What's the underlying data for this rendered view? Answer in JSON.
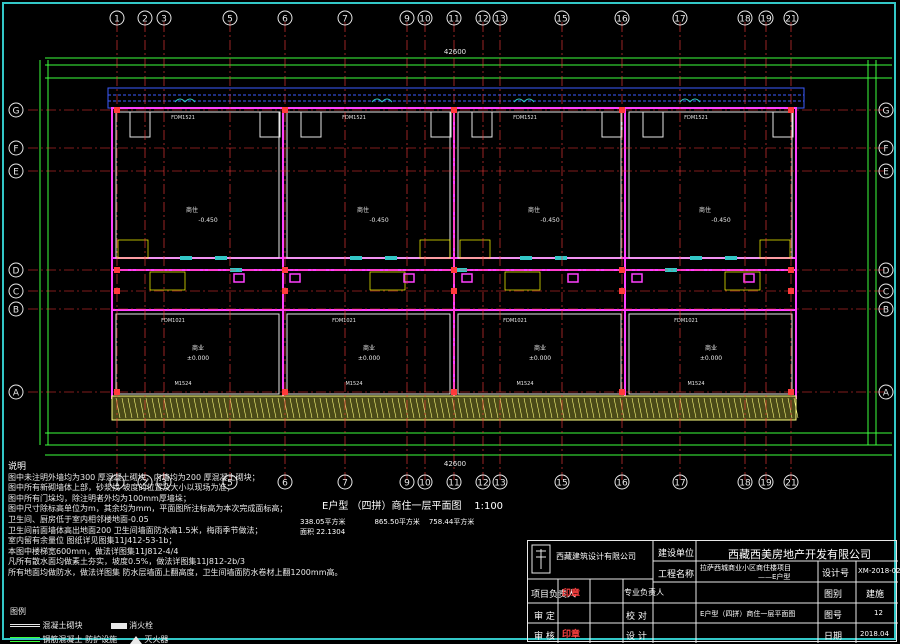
{
  "drawing_title": "E户型 （四拼）商住一层平面图",
  "scale": "1:100",
  "area_line_1": "338.05平方米",
  "area_line_1b": "865.50平方米",
  "area_line_1c": "758.44平方米",
  "area_line_2": "面积 22.1304",
  "axis_numbers": [
    "1",
    "2",
    "3",
    "5",
    "6",
    "7",
    "9",
    "10",
    "11",
    "12",
    "13",
    "15",
    "16",
    "17",
    "18",
    "19",
    "21"
  ],
  "axis_letters": [
    "G",
    "F",
    "E",
    "D",
    "C",
    "B",
    "A"
  ],
  "total_dim": "42600",
  "room_labels": [
    "商住",
    "商住",
    "商住",
    "商住"
  ],
  "elev_labels": [
    "-0.450",
    "-0.450",
    "-0.450",
    "-0.450"
  ],
  "shop_labels": [
    "商业",
    "商业",
    "商业",
    "商业"
  ],
  "shop_elev": [
    "±0.000",
    "±0.000",
    "±0.000",
    "±0.000"
  ],
  "door_codes": [
    "FDM1521",
    "FDM1521",
    "FDM1521",
    "FDM1521",
    "M1524",
    "M1524",
    "M1524",
    "M1524",
    "FDM1021",
    "FDM1021",
    "FDM1021",
    "FDM1021"
  ],
  "notes": {
    "heading": "说明",
    "lines": [
      "图中未注明外墙均为300 厚混凝土砌块，内墙均为200 厚混凝土砌块；",
      "图中所有新砌墙体上部，砂浆找 坡度的位置及大小以现场为准；",
      "图中所有门垛均，除注明者外均为100mm厚墙垛；",
      "图中尺寸除标高单位为m，其余均为mm，平面图所注标高为本次完成面标高；",
      "   卫生间、厨房低于室内相邻楼地面-0.05",
      "卫生间前面墙体高出地面200 卫生间墙面防水高1.5米，梅雨季节做法；",
      "室内留有余量位 图纸详见图集11J412-53-1b；",
      "本图中楼梯宽600mm，做法详图集11J812-4/4",
      "凡所有散水面均做素土夯实，坡度0.5%，做法详图集11J812-2b/3",
      "所有地面均做防水，做法详图集 防水层墙面上翻高度，卫生间墙面防水卷材上翻1200mm高。"
    ],
    "legend_heading": "图例",
    "legend_items": [
      "混凝土砌块",
      "消火栓",
      "钢筋混凝土 防护设施",
      "灭火器"
    ]
  },
  "title_block": {
    "designer_company": "西藏建筑设计有限公司",
    "client_label": "建设单位",
    "client": "西藏西美房地产开发有限公司",
    "project_label": "工程名称",
    "project": "拉萨西城商业小区商住楼项目",
    "sub_project": "——E户型",
    "design_no_label": "设计号",
    "design_no": "XM-2018-023",
    "discipline_label": "图别",
    "discipline": "建施",
    "sheet_label": "图号",
    "sheet_no": "12",
    "date_label": "日期",
    "date": "2018.04",
    "drawing_name": "E户型（四拼）商住一层平面图",
    "roles": [
      "项目负责人",
      "专业负责人",
      "审 定",
      "校 对",
      "审 核",
      "设 计"
    ],
    "seal_text": "印章"
  },
  "colors": {
    "background": "#000000",
    "axis": "#ff3b3b",
    "wall": "#ff40ff",
    "dimension": "#3dff3d",
    "annotation": "#ffff00",
    "hatch": "#ffff80",
    "cyan": "#33c7c7"
  }
}
